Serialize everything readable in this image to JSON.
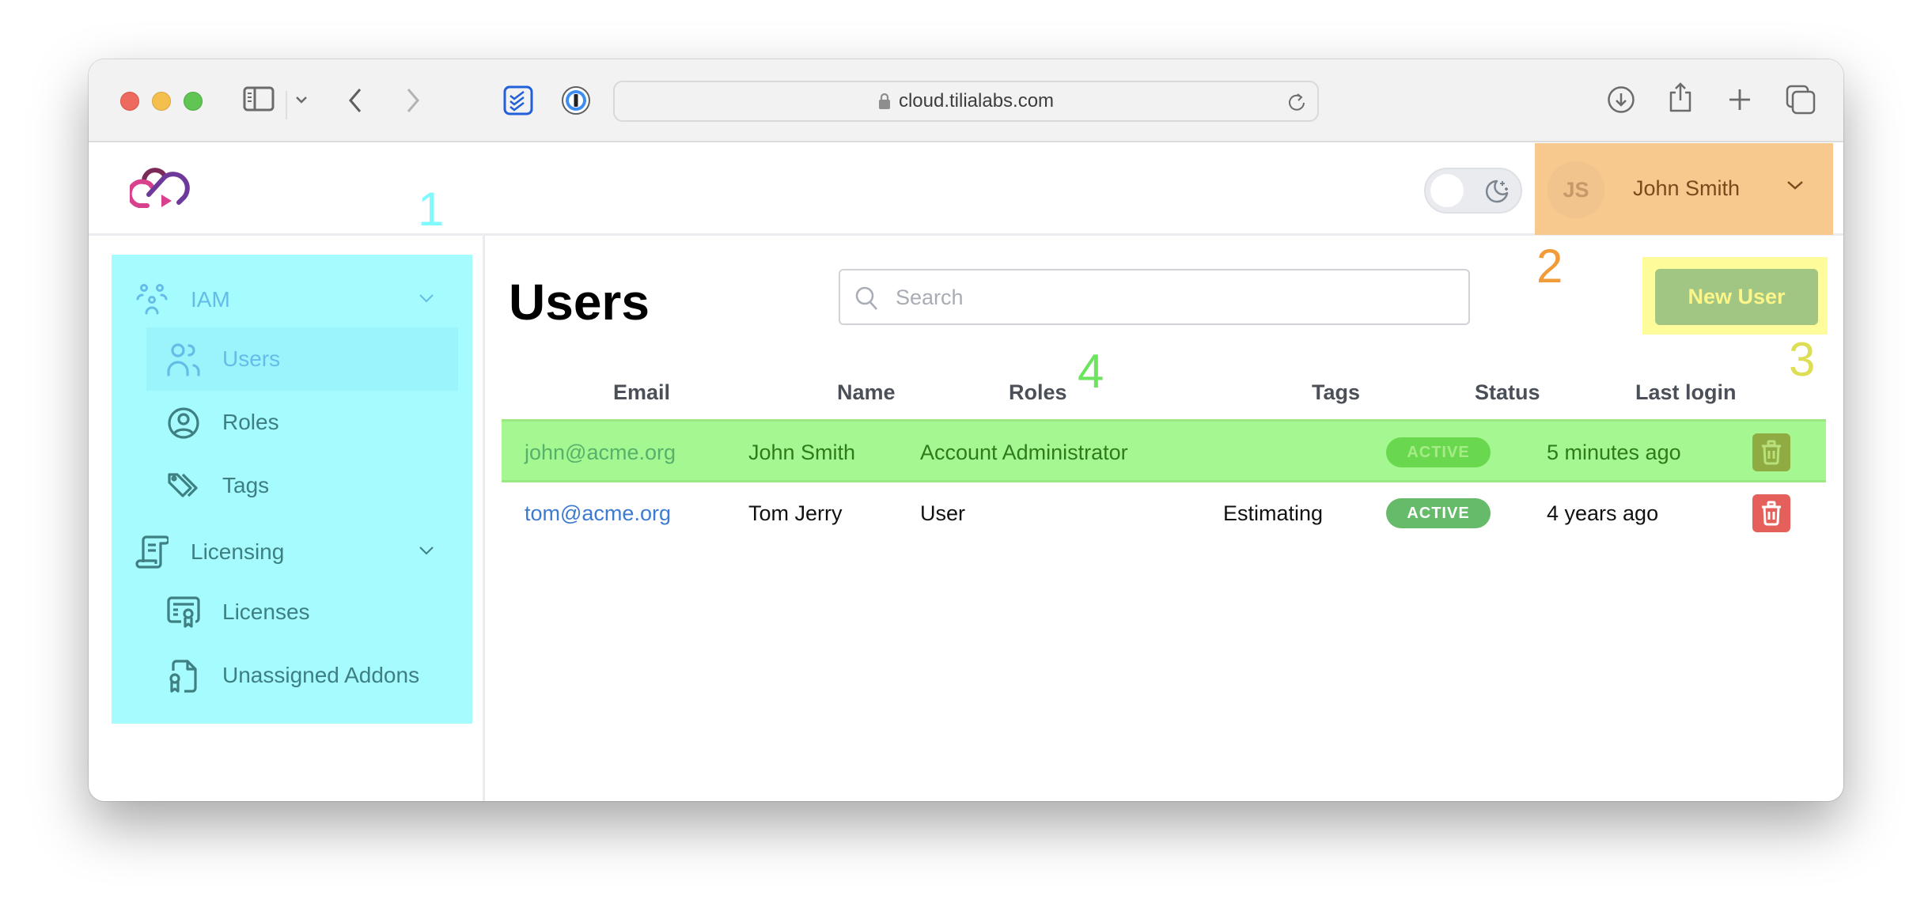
{
  "browser": {
    "url": "cloud.tilialabs.com",
    "icons": [
      "sidebar-toggle-icon",
      "chevron-down-icon",
      "back-icon",
      "forward-icon",
      "todoist-extension-icon",
      "onepassword-extension-icon",
      "lock-icon",
      "reload-icon",
      "download-icon",
      "share-icon",
      "new-tab-icon",
      "tab-overview-icon"
    ]
  },
  "header": {
    "logo": "cloud-play-logo",
    "user": {
      "initials": "JS",
      "name": "John Smith"
    },
    "theme_toggle": {
      "state": "light",
      "icon": "moon-stars-icon"
    }
  },
  "annotations": {
    "a1": "1",
    "a2": "2",
    "a3": "3",
    "a4": "4"
  },
  "sidebar": {
    "groups": [
      {
        "label": "IAM",
        "icon": "user-group-icon",
        "expanded": true,
        "items": [
          {
            "label": "Users",
            "icon": "users-icon",
            "active": true
          },
          {
            "label": "Roles",
            "icon": "user-circle-icon",
            "active": false
          },
          {
            "label": "Tags",
            "icon": "tags-icon",
            "active": false
          }
        ]
      },
      {
        "label": "Licensing",
        "icon": "scroll-icon",
        "expanded": true,
        "items": [
          {
            "label": "Licenses",
            "icon": "certificate-icon",
            "active": false
          },
          {
            "label": "Unassigned Addons",
            "icon": "file-award-icon",
            "active": false
          }
        ]
      }
    ]
  },
  "main": {
    "title": "Users",
    "search": {
      "placeholder": "Search",
      "value": ""
    },
    "new_user_label": "New User",
    "table": {
      "columns": [
        "Email",
        "Name",
        "Roles",
        "Tags",
        "Status",
        "Last login"
      ],
      "rows": [
        {
          "email": "john@acme.org",
          "name": "John Smith",
          "roles": "Account Administrator",
          "tags": "",
          "status": "ACTIVE",
          "last_login": "5 minutes ago",
          "highlighted": true
        },
        {
          "email": "tom@acme.org",
          "name": "Tom Jerry",
          "roles": "User",
          "tags": "Estimating",
          "status": "ACTIVE",
          "last_login": "4 years ago",
          "highlighted": false
        }
      ]
    }
  },
  "colors": {
    "annotation_1": "#7ffbff",
    "annotation_2": "#f29b3a",
    "annotation_3": "#dede55",
    "annotation_4": "#6de45e",
    "sidebar_highlight": "#a5fbfd",
    "user_highlight": "#f7c98f",
    "button_highlight": "#fefb9a",
    "row_highlight": "#a5f792",
    "status_active": "#66bb6a",
    "delete": "#e5605b",
    "link": "#3c7bd0"
  }
}
